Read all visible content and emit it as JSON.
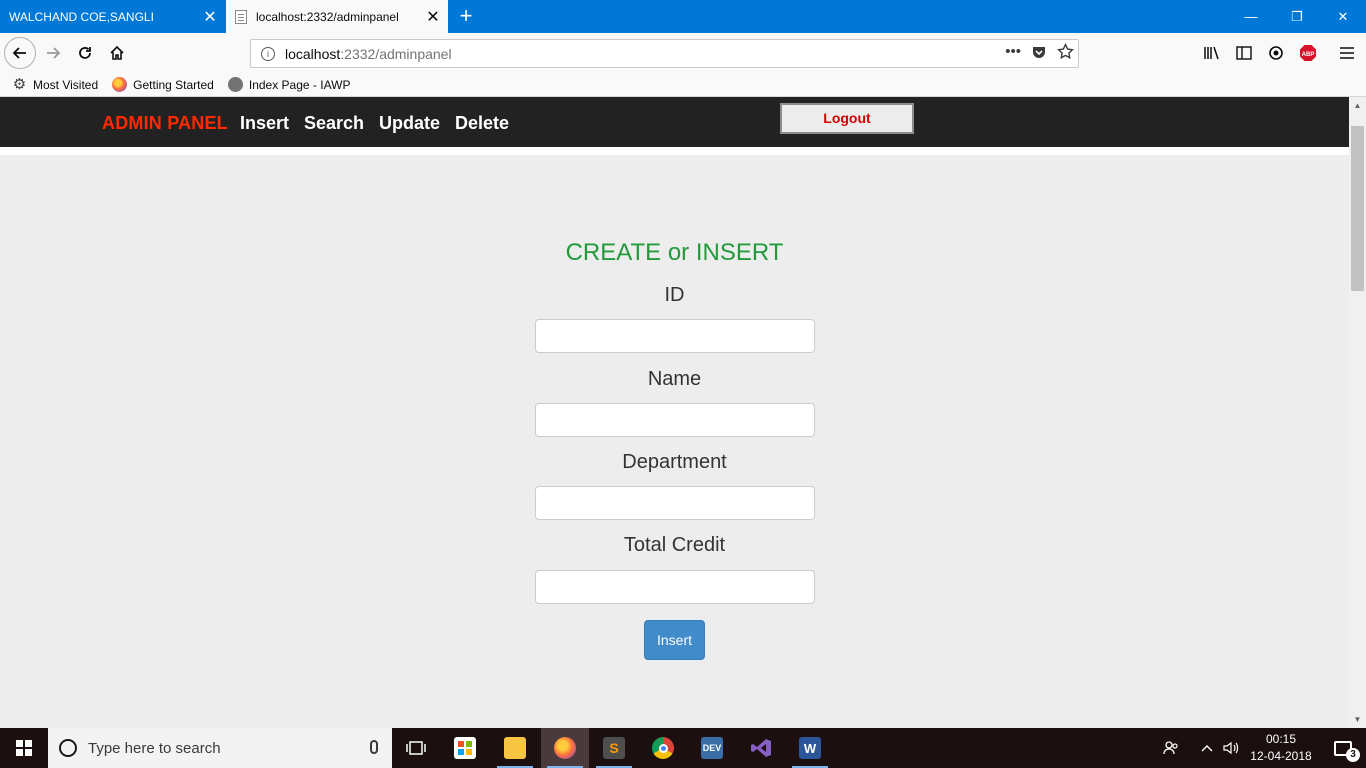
{
  "browser": {
    "tabs": [
      {
        "label": "WALCHAND COE,SANGLI",
        "active": false
      },
      {
        "label": "localhost:2332/adminpanel",
        "active": true
      }
    ],
    "url_host": "localhost",
    "url_path": ":2332/adminpanel",
    "bookmarks": [
      {
        "label": "Most Visited",
        "icon": "gear-icon"
      },
      {
        "label": "Getting Started",
        "icon": "firefox-icon"
      },
      {
        "label": "Index Page - IAWP",
        "icon": "globe-icon"
      }
    ],
    "window_controls": {
      "minimize": "—",
      "restore": "❐",
      "close": "✕"
    }
  },
  "admin": {
    "brand": "ADMIN PANEL",
    "menu": {
      "insert": "Insert",
      "search": "Search",
      "update": "Update",
      "delete": "Delete"
    },
    "logout_label": "Logout",
    "brand_color": "#ff2a00"
  },
  "form": {
    "title": "CREATE or INSERT",
    "title_color": "#229a3a",
    "fields": [
      {
        "label": "ID",
        "value": ""
      },
      {
        "label": "Name",
        "value": ""
      },
      {
        "label": "Department",
        "value": ""
      },
      {
        "label": "Total Credit",
        "value": ""
      }
    ],
    "submit_label": "Insert",
    "submit_color": "#428bca"
  },
  "taskbar": {
    "search_placeholder": "Type here to search",
    "time": "00:15",
    "date": "12-04-2018",
    "notification_count": "3",
    "apps": [
      "task-view",
      "store",
      "file-explorer",
      "firefox",
      "sublime-text",
      "chrome",
      "visual-studio-dev",
      "visual-studio",
      "word"
    ]
  }
}
